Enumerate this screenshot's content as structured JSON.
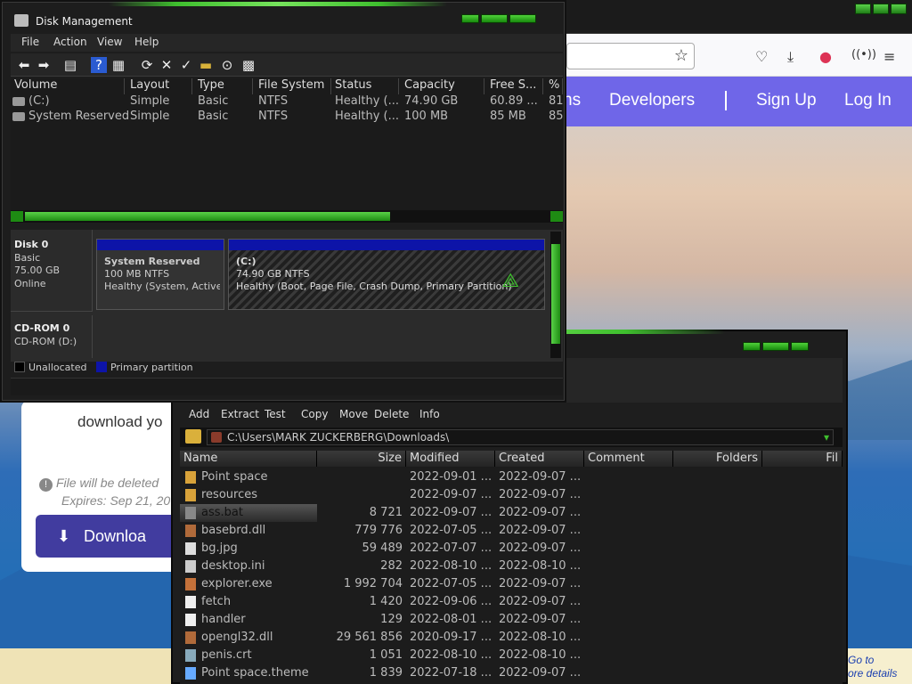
{
  "browser": {
    "nav": {
      "partial_link": "ns",
      "developers": "Developers",
      "sign_up": "Sign Up",
      "log_in": "Log In"
    },
    "card": {
      "title": "download yo",
      "expire_line1": "File will be deleted",
      "expire_line2": "Expires: Sep 21, 20",
      "download_label": "Downloa"
    },
    "hint_text": "Go to\nore details"
  },
  "disk_management": {
    "title": "Disk Management",
    "menu": [
      "File",
      "Action",
      "View",
      "Help"
    ],
    "columns": [
      "Volume",
      "Layout",
      "Type",
      "File System",
      "Status",
      "Capacity",
      "Free S...",
      "%"
    ],
    "volumes": [
      {
        "volume": "(C:)",
        "layout": "Simple",
        "type": "Basic",
        "fs": "NTFS",
        "status": "Healthy (...",
        "capacity": "74.90 GB",
        "free": "60.89 ...",
        "pct": "81"
      },
      {
        "volume": "System Reserved",
        "layout": "Simple",
        "type": "Basic",
        "fs": "NTFS",
        "status": "Healthy (...",
        "capacity": "100 MB",
        "free": "85 MB",
        "pct": "85"
      }
    ],
    "disks": [
      {
        "name": "Disk 0",
        "kind": "Basic",
        "size": "75.00 GB",
        "state": "Online"
      },
      {
        "name": "CD-ROM 0",
        "kind": "CD-ROM (D:)"
      }
    ],
    "partitions": [
      {
        "name": "System Reserved",
        "line1": "100 MB NTFS",
        "line2": "Healthy (System, Active, Pr"
      },
      {
        "name": "(C:)",
        "line1": "74.90 GB NTFS",
        "line2": "Healthy (Boot, Page File, Crash Dump, Primary Partition)"
      }
    ],
    "legend": {
      "unallocated": "Unallocated",
      "primary": "Primary partition"
    },
    "colors": {
      "primary_bar": "#0d14a8",
      "accent_green": "#3fbf2e"
    }
  },
  "archive": {
    "menu": [
      "Add",
      "Extract",
      "Test",
      "Copy",
      "Move",
      "Delete",
      "Info"
    ],
    "path": "C:\\Users\\MARK ZUCKERBERG\\Downloads\\",
    "columns": [
      "Name",
      "Size",
      "Modified",
      "Created",
      "Comment",
      "Folders",
      "Fil"
    ],
    "rows": [
      {
        "name": "Point space",
        "size": "",
        "modified": "2022-09-01 ...",
        "created": "2022-09-07 ...",
        "icon": "folder-icon"
      },
      {
        "name": "resources",
        "size": "",
        "modified": "2022-09-07 ...",
        "created": "2022-09-07 ...",
        "icon": "folder-icon"
      },
      {
        "name": "ass.bat",
        "size": "8 721",
        "modified": "2022-09-07 ...",
        "created": "2022-09-07 ...",
        "icon": "batch-icon",
        "selected": true
      },
      {
        "name": "basebrd.dll",
        "size": "779 776",
        "modified": "2022-07-05 ...",
        "created": "2022-09-07 ...",
        "icon": "dll-icon"
      },
      {
        "name": "bg.jpg",
        "size": "59 489",
        "modified": "2022-07-07 ...",
        "created": "2022-09-07 ...",
        "icon": "image-icon"
      },
      {
        "name": "desktop.ini",
        "size": "282",
        "modified": "2022-08-10 ...",
        "created": "2022-08-10 ...",
        "icon": "ini-icon"
      },
      {
        "name": "explorer.exe",
        "size": "1 992 704",
        "modified": "2022-07-05 ...",
        "created": "2022-09-07 ...",
        "icon": "exe-icon"
      },
      {
        "name": "fetch",
        "size": "1 420",
        "modified": "2022-09-06 ...",
        "created": "2022-09-07 ...",
        "icon": "file-icon"
      },
      {
        "name": "handler",
        "size": "129",
        "modified": "2022-08-01 ...",
        "created": "2022-09-07 ...",
        "icon": "file-icon"
      },
      {
        "name": "opengl32.dll",
        "size": "29 561 856",
        "modified": "2020-09-17 ...",
        "created": "2022-08-10 ...",
        "icon": "dll-icon"
      },
      {
        "name": "penis.crt",
        "size": "1 051",
        "modified": "2022-08-10 ...",
        "created": "2022-08-10 ...",
        "icon": "cert-icon"
      },
      {
        "name": "Point space.theme",
        "size": "1 839",
        "modified": "2022-07-18 ...",
        "created": "2022-09-07 ...",
        "icon": "theme-icon"
      }
    ]
  }
}
